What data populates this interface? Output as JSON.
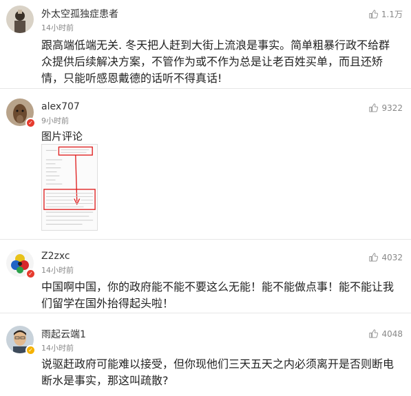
{
  "comments": [
    {
      "username": "外太空孤独症患者",
      "time": "14小时前",
      "likes": "1.1万",
      "content": "跟高端低端无关. 冬天把人赶到大街上流浪是事实。简单粗暴行政不给群众提供后续解决方案，不管作为或不作为总是让老百姓买单，而且还矫情，只能听感恩戴德的话听不得真话!"
    },
    {
      "username": "alex707",
      "time": "9小时前",
      "likes": "9322",
      "image_label": "图片评论"
    },
    {
      "username": "Z2zxc",
      "time": "14小时前",
      "likes": "4032",
      "content": "中国啊中国，你的政府能不能不要这么无能！能不能做点事！能不能让我们留学在国外抬得起头啦！"
    },
    {
      "username": "雨起云端1",
      "time": "14小时前",
      "likes": "4048",
      "content": "说驱赶政府可能难以接受，但你现他们三天五天之内必须离开是否则断电断水是事实，那这叫疏散?"
    }
  ],
  "colors": {
    "verified_red": "#e63b2e",
    "verified_yellow": "#f5b100",
    "meta_gray": "#888888",
    "divider": "#e6e6e6"
  },
  "icons": {
    "like": "thumbs-up-icon",
    "badge": "verified-badge-icon"
  }
}
